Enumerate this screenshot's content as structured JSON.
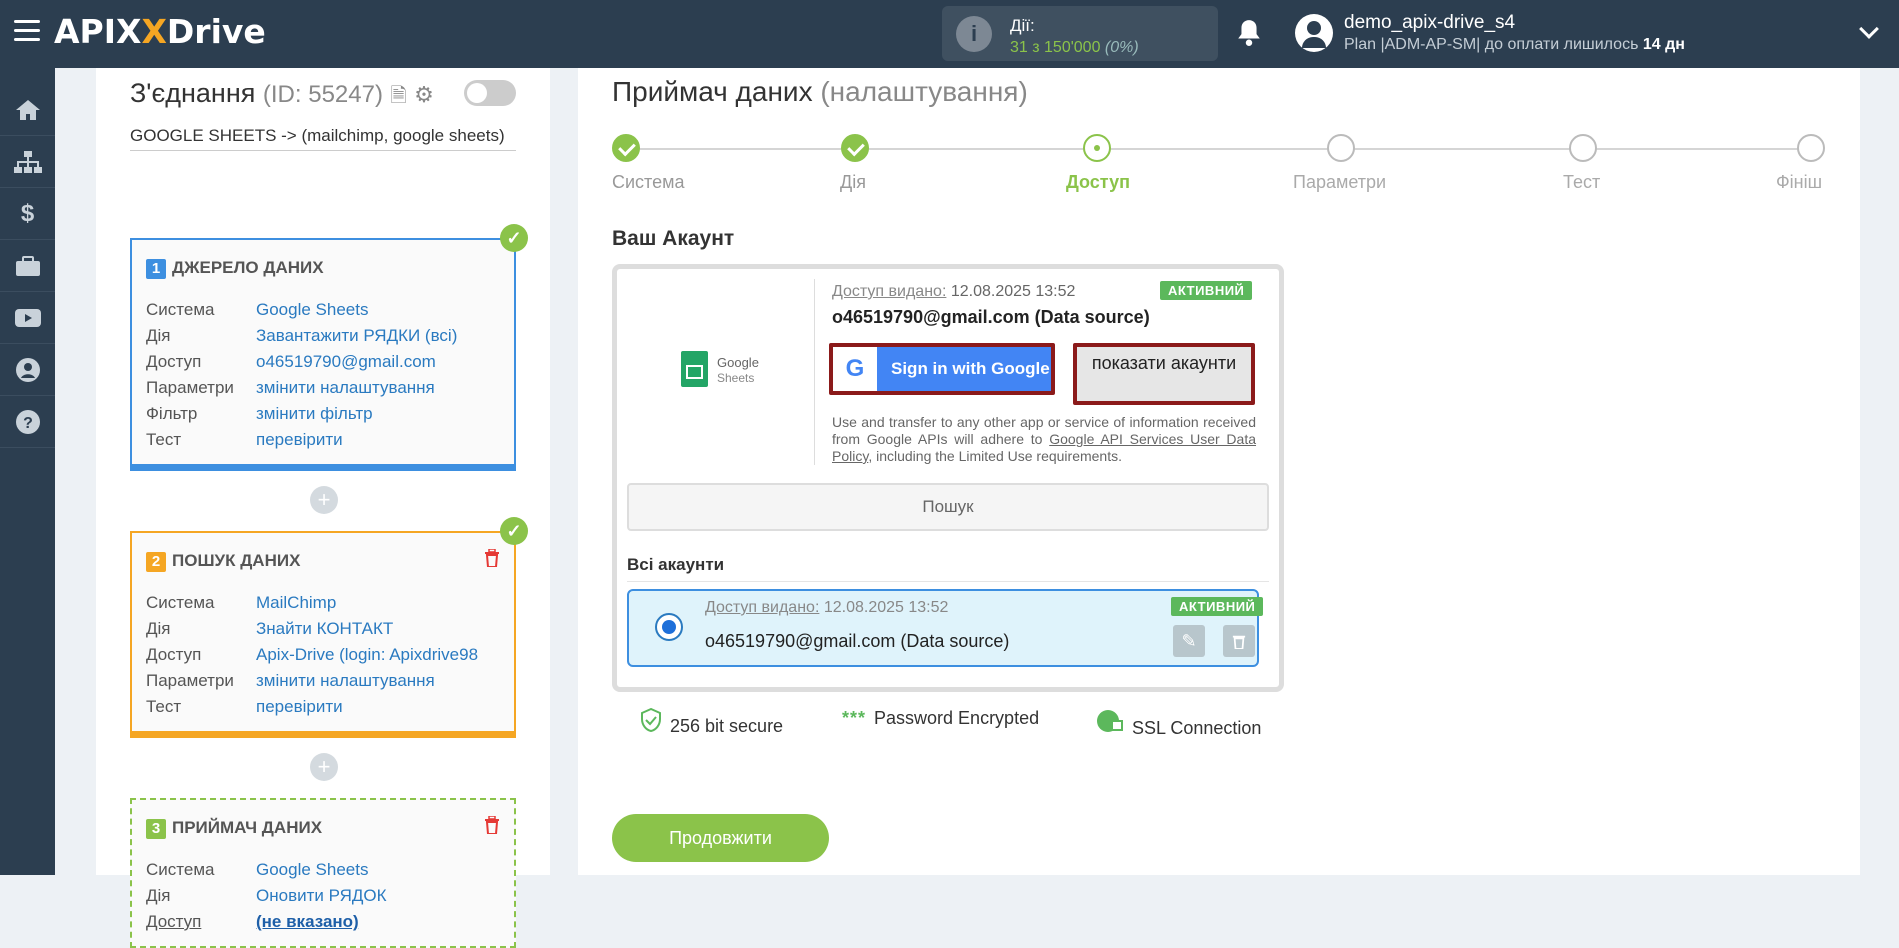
{
  "header": {
    "logo_prefix": "APIX",
    "logo_suffix": "Drive",
    "actions_label": "Дії:",
    "actions_value": "31 з 150'000",
    "actions_pct": "(0%)",
    "username": "demo_apix-drive_s4",
    "plan_text": "Plan |ADM-AP-SM| до оплати лишилось",
    "plan_days": "14 дн"
  },
  "sidebar": {
    "items": [
      {
        "icon": "home-icon"
      },
      {
        "icon": "sitemap-icon"
      },
      {
        "icon": "dollar-icon"
      },
      {
        "icon": "briefcase-icon"
      },
      {
        "icon": "youtube-icon"
      },
      {
        "icon": "user-circle-icon"
      },
      {
        "icon": "help-icon"
      }
    ]
  },
  "connection": {
    "title": "З'єднання",
    "id": "(ID: 55247)",
    "subtitle": "GOOGLE SHEETS -> (mailchimp, google sheets)",
    "blocks": [
      {
        "num": "1",
        "title": "ДЖЕРЕЛО ДАНИХ",
        "rows": [
          {
            "k": "Система",
            "v": "Google Sheets"
          },
          {
            "k": "Дія",
            "v": "Завантажити РЯДКИ (всі)"
          },
          {
            "k": "Доступ",
            "v": "o46519790@gmail.com"
          },
          {
            "k": "Параметри",
            "v": "змінити налаштування"
          },
          {
            "k": "Фільтр",
            "v": "змінити фільтр"
          },
          {
            "k": "Тест",
            "v": "перевірити"
          }
        ]
      },
      {
        "num": "2",
        "title": "ПОШУК ДАНИХ",
        "rows": [
          {
            "k": "Система",
            "v": "MailChimp"
          },
          {
            "k": "Дія",
            "v": "Знайти КОНТАКТ"
          },
          {
            "k": "Доступ",
            "v": "Apix-Drive (login: Apixdrive98"
          },
          {
            "k": "Параметри",
            "v": "змінити налаштування"
          },
          {
            "k": "Тест",
            "v": "перевірити"
          }
        ]
      },
      {
        "num": "3",
        "title": "ПРИЙМАЧ ДАНИХ",
        "rows": [
          {
            "k": "Система",
            "v": "Google Sheets"
          },
          {
            "k": "Дія",
            "v": "Оновити РЯДОК"
          },
          {
            "k": "Доступ",
            "v": "(не вказано)"
          }
        ]
      }
    ]
  },
  "main": {
    "title": "Приймач даних",
    "title_sub": "(налаштування)",
    "steps": [
      "Система",
      "Дія",
      "Доступ",
      "Параметри",
      "Тест",
      "Фініш"
    ],
    "account_title": "Ваш Акаунт",
    "gs_logo_1": "Google",
    "gs_logo_2": "Sheets",
    "granted_label": "Доступ видано:",
    "granted_date": "12.08.2025 13:52",
    "active_badge": "АКТИВНИЙ",
    "account_email": "o46519790@gmail.com (Data source)",
    "google_btn": "Sign in with Google",
    "show_accounts_btn": "показати акаунти",
    "policy_1": "Use and transfer to any other app or service of information received from Google APIs will adhere to",
    "policy_link": "Google API Services User Data Policy",
    "policy_2": ", including the Limited Use requirements.",
    "search_btn": "Пошук",
    "all_accounts": "Всі акаунти",
    "item_email": "o46519790@gmail.com (Data source)",
    "security": [
      "256 bit secure",
      "Password Encrypted",
      "SSL Connection"
    ],
    "continue_btn": "Продовжити"
  },
  "colors": {
    "topbar": "#2c3e50",
    "accent_green": "#8bc34a",
    "blue": "#3d8fe0",
    "orange": "#f5a623"
  }
}
